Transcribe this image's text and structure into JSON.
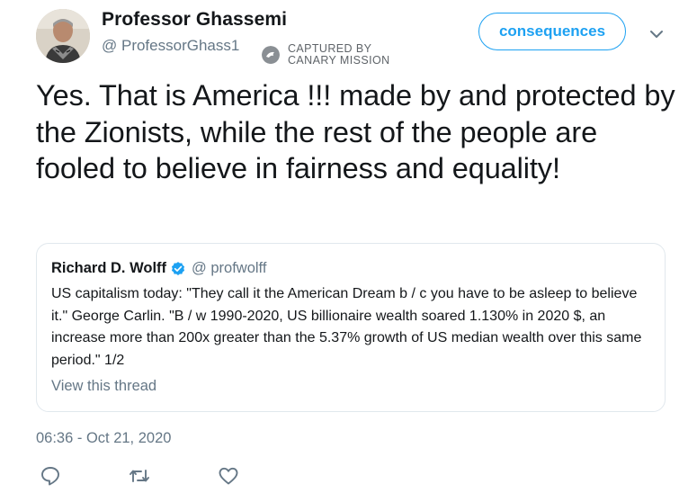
{
  "author": {
    "name": "Professor Ghassemi",
    "handle": "@ ProfessorGhass1",
    "avatar_icon": "avatar-photo"
  },
  "watermark": {
    "line1": "CAPTURED BY",
    "line2": "CANARY MISSION",
    "icon": "canary-logo-icon"
  },
  "follow_button_label": "consequences",
  "menu_icon": "chevron-down-icon",
  "tweet_text": "Yes. That is America !!! made by and protected by the Zionists, while the rest of the people are fooled to believe in fairness and equality!",
  "quoted": {
    "name": "Richard D. Wolff",
    "verified_icon": "verified-badge-icon",
    "handle": "@ profwolff",
    "text": "US capitalism today: \"They call it the American Dream b / c you have to be asleep to believe it.\" George Carlin. \"B / w 1990-2020, US billionaire wealth soared 1.130% in 2020 $, an increase more than 200x greater than the 5.37% growth of US median wealth over this same period.\" 1/2",
    "thread_link": "View this thread"
  },
  "timestamp": "06:36 - Oct 21, 2020",
  "actions": [
    "reply-icon",
    "retweet-icon",
    "like-icon"
  ],
  "colors": {
    "accent": "#1da1f2",
    "secondary_text": "#657786",
    "border": "#e1e8ed"
  }
}
